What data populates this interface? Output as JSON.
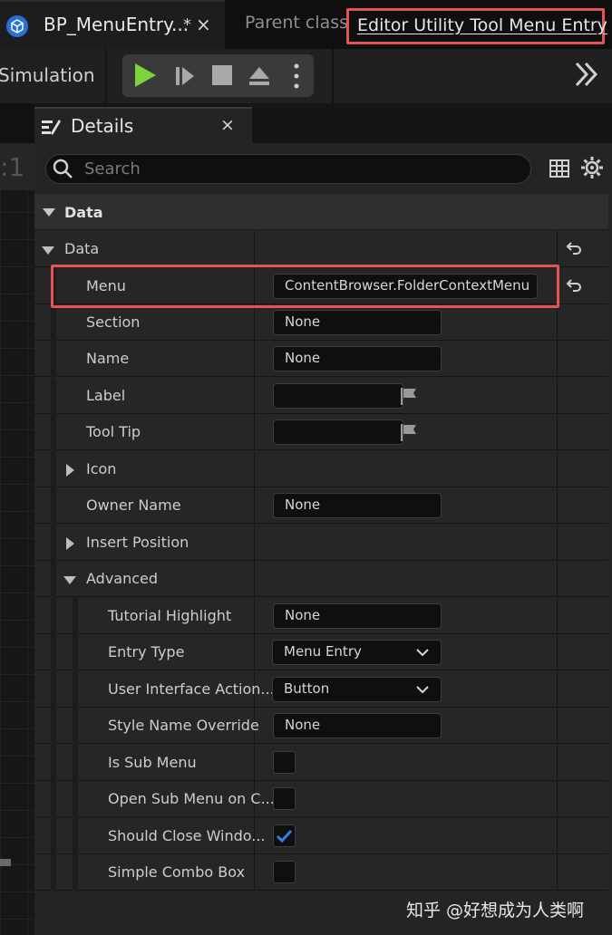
{
  "tab": {
    "title": "BP_MenuEntry...",
    "dirty": "*",
    "close": "×"
  },
  "parent": {
    "label": "Parent class",
    "value": "Editor Utility Tool Menu Entry"
  },
  "toolbar": {
    "simulation_label": "Simulation"
  },
  "graph": {
    "partial_text": ":1"
  },
  "details": {
    "title": "Details",
    "close": "×",
    "search_placeholder": "Search",
    "category": "Data",
    "group_label": "Data",
    "rows": {
      "menu": {
        "label": "Menu",
        "value": "ContentBrowser.FolderContextMenu"
      },
      "section": {
        "label": "Section",
        "value": "None"
      },
      "name": {
        "label": "Name",
        "value": "None"
      },
      "label": {
        "label": "Label",
        "value": ""
      },
      "tooltip": {
        "label": "Tool Tip",
        "value": ""
      },
      "icon": {
        "label": "Icon"
      },
      "owner_name": {
        "label": "Owner Name",
        "value": "None"
      },
      "insert_position": {
        "label": "Insert Position"
      },
      "advanced": {
        "label": "Advanced"
      },
      "tutorial_highlight": {
        "label": "Tutorial Highlight",
        "value": "None"
      },
      "entry_type": {
        "label": "Entry Type",
        "value": "Menu Entry"
      },
      "ui_action": {
        "label": "User Interface Action...",
        "value": "Button"
      },
      "style_name_override": {
        "label": "Style Name Override",
        "value": "None"
      },
      "is_sub_menu": {
        "label": "Is Sub Menu",
        "checked": false
      },
      "open_sub_menu": {
        "label": "Open Sub Menu on C...",
        "checked": false
      },
      "should_close_window": {
        "label": "Should Close Windo...",
        "checked": true
      },
      "simple_combo_box": {
        "label": "Simple Combo Box",
        "checked": false
      }
    }
  },
  "watermark": "知乎 @好想成为人类啊",
  "colors": {
    "highlight": "#e25456",
    "play": "#7cd33a",
    "check": "#2e7ff0"
  }
}
